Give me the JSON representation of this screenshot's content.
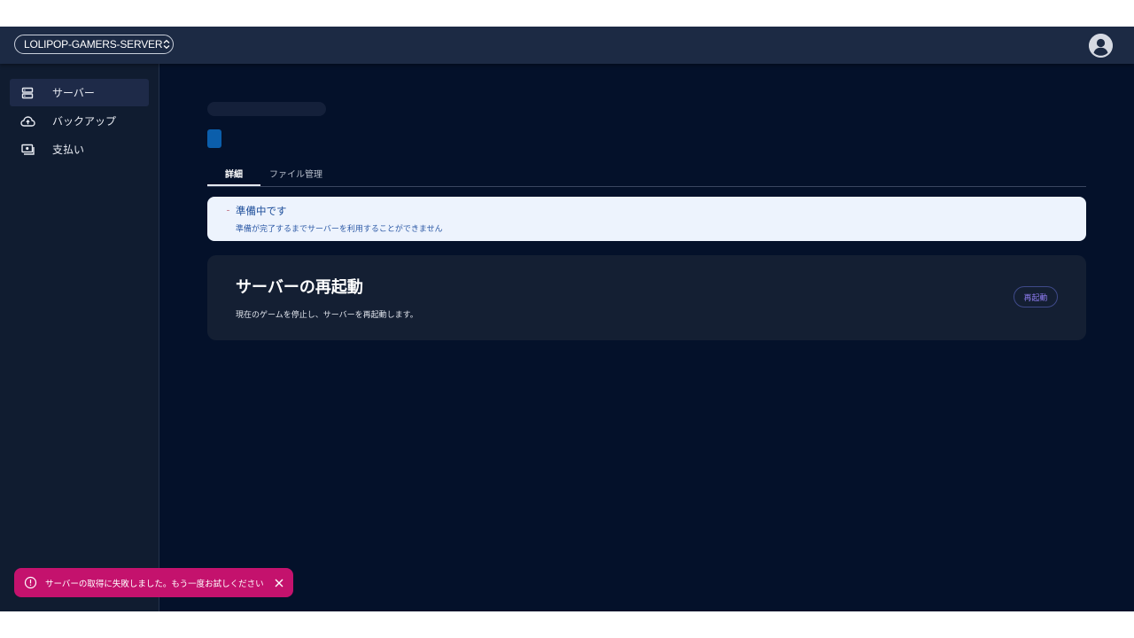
{
  "header": {
    "server_name": "LOLIPOP-GAMERS-SERVER",
    "selector_icon": "unfold-icon",
    "avatar_icon": "account-circle-icon"
  },
  "sidebar": {
    "items": [
      {
        "label": "サーバー",
        "icon": "server-icon",
        "active": true
      },
      {
        "label": "バックアップ",
        "icon": "cloud-upload-icon",
        "active": false
      },
      {
        "label": "支払い",
        "icon": "payment-icon",
        "active": false
      }
    ]
  },
  "main": {
    "tabs": [
      {
        "label": "詳細",
        "active": true
      },
      {
        "label": "ファイル管理",
        "active": false
      }
    ],
    "alert": {
      "title": "準備中です",
      "description": "準備が完了するまでサーバーを利用することができません"
    },
    "restart_card": {
      "heading": "サーバーの再起動",
      "description": "現在のゲームを停止し、サーバーを再起動します。",
      "button_label": "再起動"
    }
  },
  "toast": {
    "message": "サーバーの取得に失敗しました。もう一度お試しください",
    "icon": "error-outline-icon",
    "close_icon": "close-icon"
  },
  "colors": {
    "background": "#04112a",
    "topbar": "#1c2a44",
    "sidebar": "#101c30",
    "toast": "#c4126d",
    "alert_bg": "#edf3fd",
    "accent_blue": "#0b5eab"
  }
}
